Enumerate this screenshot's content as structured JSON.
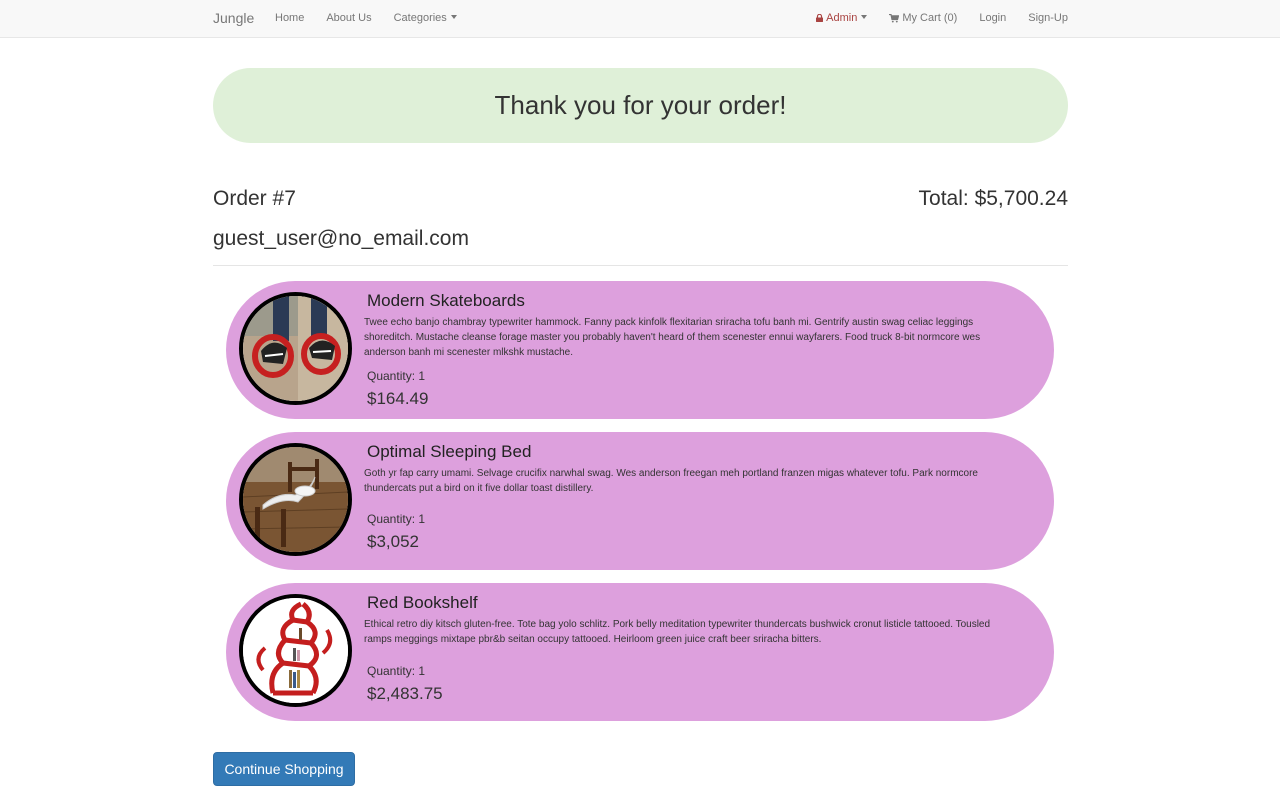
{
  "navbar": {
    "brand": "Jungle",
    "left_links": [
      "Home",
      "About Us",
      "Categories"
    ],
    "admin_label": "Admin",
    "cart_label": "My Cart (0)",
    "login_label": "Login",
    "signup_label": "Sign-Up",
    "admin_color": "#a94442"
  },
  "banner": {
    "message": "Thank you for your order!",
    "color": "#dff0d8"
  },
  "order": {
    "number_label": "Order #7",
    "total_label": "Total: $5,700.24",
    "email": "guest_user@no_email.com"
  },
  "items": [
    {
      "name": "Modern Skateboards",
      "description": "Twee echo banjo chambray typewriter hammock. Fanny pack kinfolk flexitarian sriracha tofu banh mi. Gentrify austin swag celiac leggings shoreditch. Mustache cleanse forage master you probably haven't heard of them scenester ennui wayfarers. Food truck 8-bit normcore wes anderson banh mi scenester mlkshk mustache.",
      "quantity": "Quantity: 1",
      "price": "$164.49",
      "image": "skateboard-photo"
    },
    {
      "name": "Optimal Sleeping Bed",
      "description": "Goth yr fap carry umami. Selvage crucifix narwhal swag. Wes anderson freegan meh portland franzen migas whatever tofu. Park normcore thundercats put a bird on it five dollar toast distillery.",
      "quantity": "Quantity: 1",
      "price": "$3,052",
      "image": "bed-photo"
    },
    {
      "name": "Red Bookshelf",
      "description": "Ethical retro diy kitsch gluten-free. Tote bag yolo schlitz. Pork belly meditation typewriter thundercats bushwick cronut listicle tattooed. Tousled ramps meggings mixtape pbr&b seitan occupy tattooed. Heirloom green juice craft beer sriracha bitters.",
      "quantity": "Quantity: 1",
      "price": "$2,483.75",
      "image": "bookshelf-photo"
    }
  ],
  "item_card_color": "#dda0dd",
  "continue_button": {
    "label": "Continue Shopping",
    "color": "#337ab7"
  }
}
